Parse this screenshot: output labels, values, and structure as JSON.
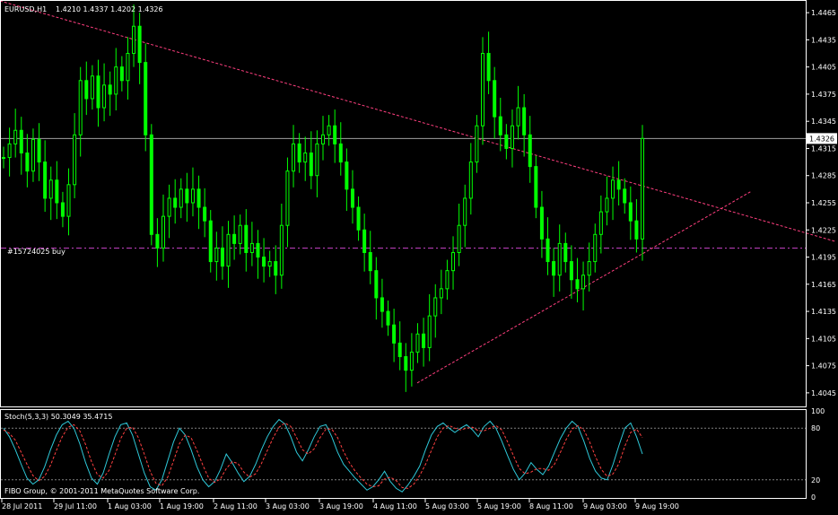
{
  "colors": {
    "background": "#000000",
    "frame": "#ffffff",
    "candle": "#00ff00",
    "trendline": "#ff3f7f",
    "order_line": "#bf3fbf",
    "price_line": "#a0a0a0",
    "stoch_main": "#2ec8d8",
    "stoch_signal": "#ff4040",
    "stoch_level": "#808080",
    "text": "#ffffff"
  },
  "chart_data": [
    {
      "type": "candlestick",
      "title": "EURUSD,H1",
      "ohlc_text": "1.4210 1.4337 1.4202 1.4326",
      "ylim": [
        1.403,
        1.4478
      ],
      "y_ticks": [
        "1.4465",
        "1.4435",
        "1.4405",
        "1.4375",
        "1.4345",
        "1.4315",
        "1.4285",
        "1.4255",
        "1.4225",
        "1.4195",
        "1.4165",
        "1.4135",
        "1.4105",
        "1.4075",
        "1.4045"
      ],
      "current_price": "1.4326",
      "x_ticks": [
        "28 Jul 2011",
        "29 Jul 11:00",
        "1 Aug 03:00",
        "1 Aug 19:00",
        "2 Aug 11:00",
        "3 Aug 03:00",
        "3 Aug 19:00",
        "4 Aug 11:00",
        "5 Aug 03:00",
        "5 Aug 19:00",
        "8 Aug 11:00",
        "9 Aug 03:00",
        "9 Aug 19:00"
      ],
      "order_label": "#15724025 buy",
      "order_price": 1.4205,
      "close": [
        1.4305,
        1.432,
        1.4335,
        1.431,
        1.429,
        1.4325,
        1.43,
        1.426,
        1.428,
        1.4255,
        1.424,
        1.4275,
        1.433,
        1.439,
        1.437,
        1.4395,
        1.436,
        1.4385,
        1.4375,
        1.4405,
        1.439,
        1.442,
        1.445,
        1.441,
        1.433,
        1.422,
        1.4205,
        1.424,
        1.426,
        1.425,
        1.427,
        1.4255,
        1.427,
        1.425,
        1.4235,
        1.419,
        1.4205,
        1.4185,
        1.422,
        1.421,
        1.423,
        1.42,
        1.421,
        1.4195,
        1.4185,
        1.419,
        1.4175,
        1.423,
        1.429,
        1.432,
        1.43,
        1.431,
        1.4285,
        1.432,
        1.433,
        1.434,
        1.432,
        1.43,
        1.427,
        1.425,
        1.4225,
        1.42,
        1.418,
        1.415,
        1.4135,
        1.412,
        1.41,
        1.4085,
        1.407,
        1.409,
        1.411,
        1.4095,
        1.413,
        1.415,
        1.416,
        1.418,
        1.42,
        1.423,
        1.426,
        1.43,
        1.434,
        1.442,
        1.439,
        1.435,
        1.433,
        1.4315,
        1.434,
        1.436,
        1.433,
        1.4295,
        1.425,
        1.4215,
        1.419,
        1.4175,
        1.421,
        1.419,
        1.417,
        1.416,
        1.4175,
        1.419,
        1.422,
        1.4245,
        1.426,
        1.428,
        1.427,
        1.4255,
        1.4235,
        1.4215,
        1.4326
      ],
      "annotations": {
        "down_trendline": [
          [
            0,
            1.4478
          ],
          [
            932,
            1.4212
          ]
        ],
        "up_trendline": [
          [
            465,
            1.4056
          ],
          [
            838,
            1.4268
          ]
        ]
      }
    },
    {
      "type": "line",
      "title": "Stoch(5,3,3) 50.3049 35.4715",
      "ylim": [
        0,
        100
      ],
      "y_ticks": [
        "100",
        "80",
        "20",
        "0"
      ],
      "levels": [
        80,
        20
      ],
      "series": [
        {
          "name": "Stoch main",
          "values": [
            80,
            70,
            55,
            38,
            22,
            15,
            20,
            35,
            55,
            72,
            84,
            88,
            80,
            62,
            40,
            22,
            15,
            28,
            50,
            70,
            84,
            86,
            72,
            50,
            28,
            12,
            8,
            20,
            42,
            64,
            80,
            72,
            55,
            35,
            20,
            12,
            18,
            32,
            50,
            40,
            28,
            18,
            24,
            38,
            55,
            70,
            82,
            90,
            85,
            70,
            52,
            42,
            55,
            70,
            82,
            84,
            70,
            52,
            38,
            30,
            22,
            15,
            8,
            12,
            20,
            30,
            18,
            10,
            6,
            14,
            24,
            36,
            55,
            72,
            82,
            86,
            80,
            75,
            80,
            84,
            78,
            70,
            82,
            88,
            80,
            65,
            48,
            32,
            20,
            28,
            40,
            32,
            26,
            36,
            52,
            68,
            80,
            88,
            82,
            65,
            45,
            30,
            22,
            20,
            38,
            60,
            80,
            86,
            70,
            50
          ]
        },
        {
          "name": "Stoch signal",
          "values": [
            78,
            74,
            66,
            52,
            38,
            25,
            19,
            24,
            37,
            54,
            70,
            81,
            84,
            77,
            61,
            41,
            26,
            22,
            31,
            49,
            68,
            80,
            81,
            69,
            50,
            30,
            16,
            13,
            23,
            42,
            62,
            72,
            69,
            54,
            37,
            22,
            17,
            21,
            33,
            41,
            39,
            29,
            23,
            27,
            39,
            54,
            69,
            81,
            86,
            82,
            69,
            55,
            50,
            56,
            69,
            79,
            79,
            69,
            53,
            40,
            30,
            22,
            15,
            12,
            13,
            21,
            23,
            19,
            11,
            10,
            15,
            25,
            38,
            54,
            70,
            80,
            83,
            80,
            78,
            80,
            81,
            77,
            77,
            80,
            83,
            78,
            64,
            48,
            33,
            27,
            29,
            33,
            33,
            31,
            38,
            52,
            67,
            79,
            83,
            78,
            64,
            47,
            32,
            24,
            27,
            39,
            59,
            75,
            79,
            69
          ]
        }
      ]
    }
  ],
  "footer": {
    "copyright": "FIBO Group, © 2001-2011 MetaQuotes Software Corp."
  }
}
